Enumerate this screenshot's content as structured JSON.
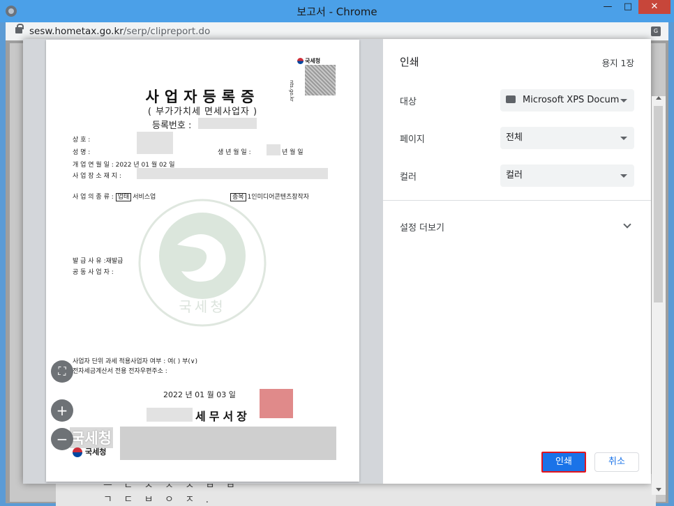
{
  "window": {
    "title": "보고서 - Chrome",
    "minimize": "—",
    "maximize": "□",
    "close": "✕"
  },
  "address": {
    "host": "sesw.hometax.go.kr",
    "path": "/serp/clipreport.do"
  },
  "background_doc": {
    "line1": "ㅡ ㄷ  ㅅ  ㅈ  ㅅ ㅂ ㅂ",
    "line2": "ㄱ ㄷ ㅂ ㅇ ㅈ ."
  },
  "document": {
    "title": "사업자등록증",
    "subtitle": "( 부가가치세 면세사업자 )",
    "reg_no_label": "등록번호 :",
    "qr_logo": "국세청",
    "qr_url": "nts.go.kr",
    "fields": {
      "trade_name": "상          호 :",
      "name": "성          명 :",
      "birth": "생 년 월 일 :",
      "birth_suffix": "년      월      일",
      "open_date": "개 업 연 월 일 : 2022 년 01 월 02 일",
      "address": "사 업 장 소 재 지 :",
      "business_type_label": "사 업 의 종 류 :",
      "type_box": "업태",
      "type_value": "서비스업",
      "item_box": "종목",
      "item_value": "1인미디어콘텐츠창작자",
      "issue_reason": "발     급     사     유 :",
      "issue_reason_value": "재발급",
      "co_owner": "공  동  사  업  자 :",
      "unit_tax": "사업자 단위 과세 적용사업자 여부 : 여(   ) 부(∨)",
      "email": "전자세금계산서 전용 전자우편주소 :"
    },
    "issue_date": "2022 년 01 월 03 일",
    "office": "세무서장",
    "footer_logo_big": "국세청",
    "footer_logo": "국세청"
  },
  "print": {
    "title": "인쇄",
    "pages": "용지 1장",
    "destination_label": "대상",
    "destination_value": "Microsoft XPS Docum",
    "pages_label": "페이지",
    "pages_value": "전체",
    "color_label": "컬러",
    "color_value": "컬러",
    "more_settings": "설정 더보기",
    "print_button": "인쇄",
    "cancel_button": "취소"
  },
  "zoom": {
    "fit": "⛶",
    "zoom_in": "+",
    "zoom_out": "−"
  },
  "colors": {
    "print_blue": "#1a73e8",
    "highlight_red": "#e3141c",
    "titlebar": "#4ba0e8"
  }
}
